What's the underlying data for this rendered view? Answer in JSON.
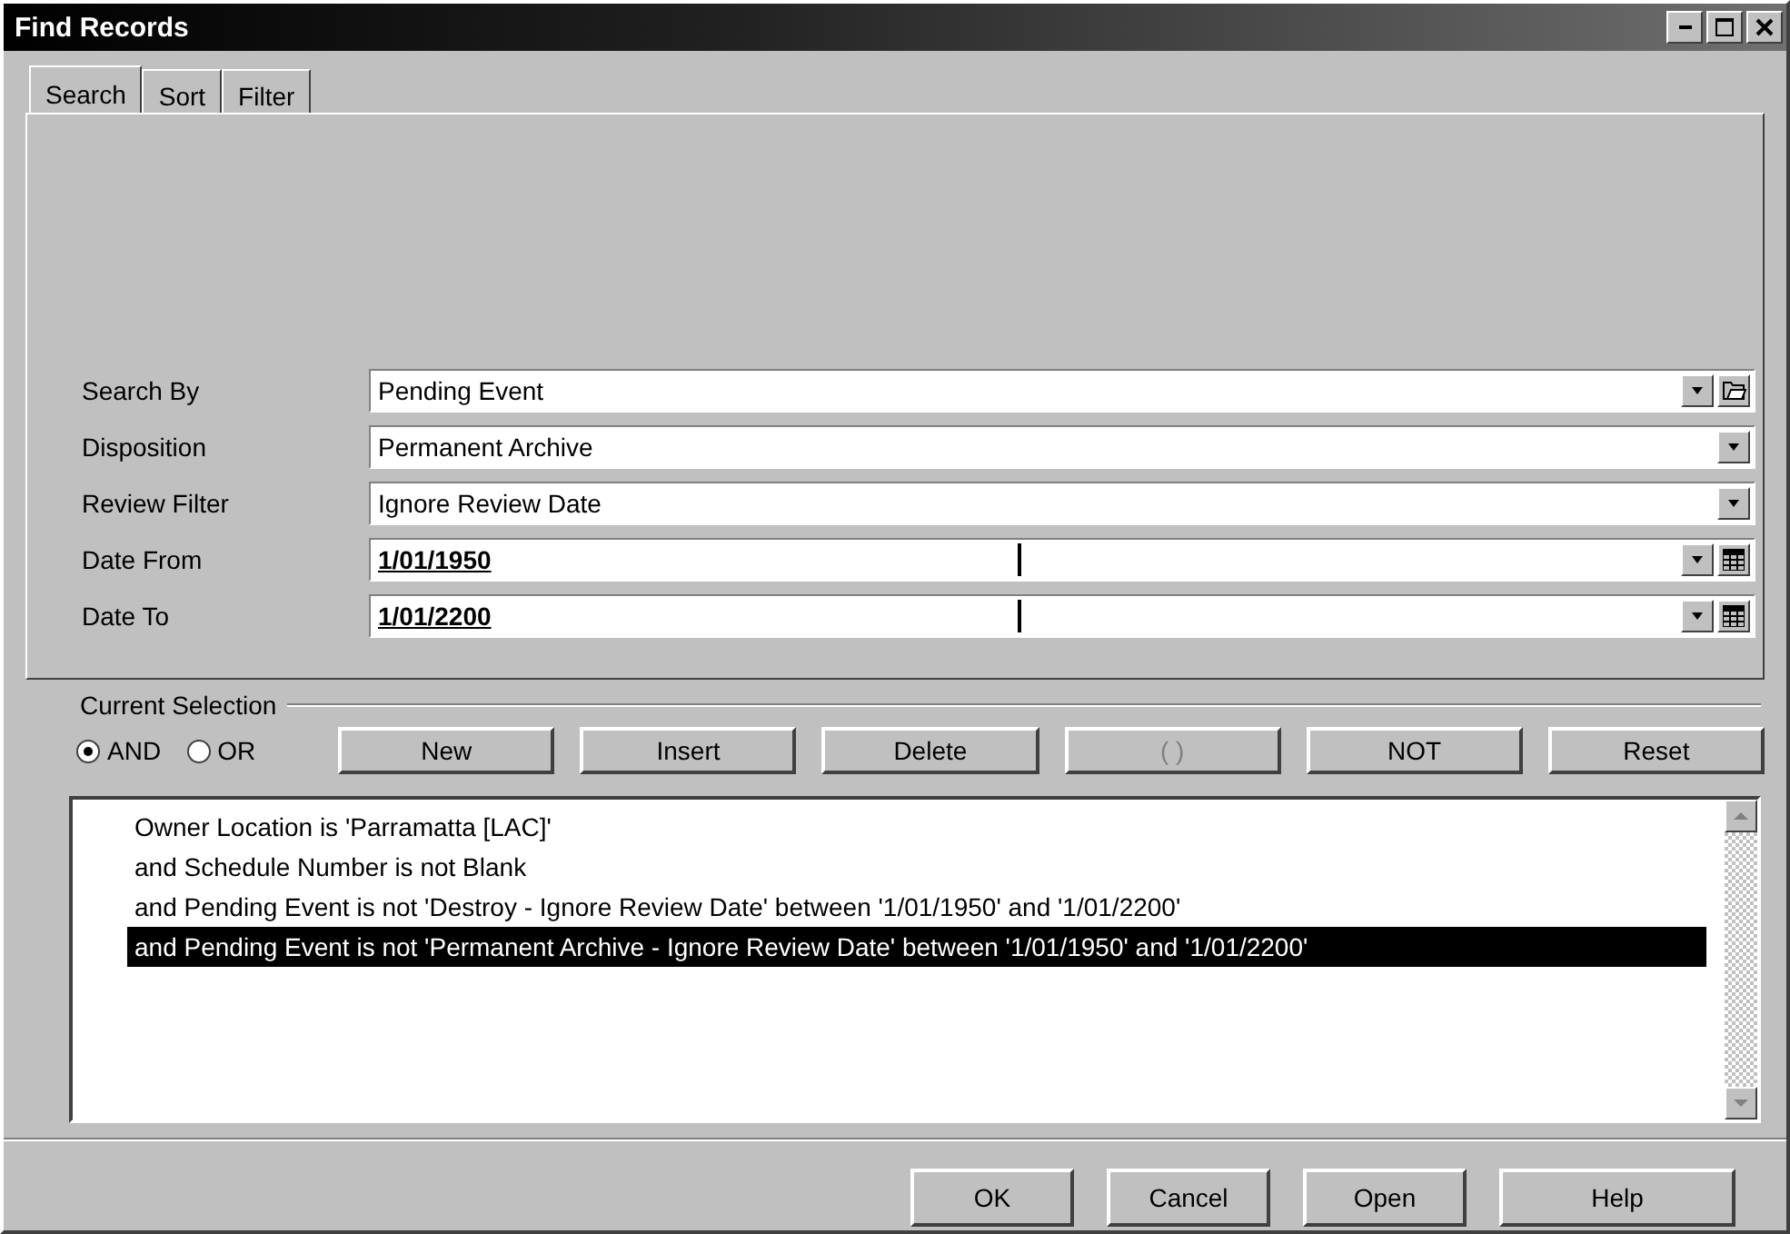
{
  "window": {
    "title": "Find Records"
  },
  "tabs": [
    {
      "label": "Search",
      "selected": true
    },
    {
      "label": "Sort",
      "selected": false
    },
    {
      "label": "Filter",
      "selected": false
    }
  ],
  "fields": [
    {
      "kind": "combo",
      "label": "Search By",
      "value": "Pending Event",
      "browse": true
    },
    {
      "kind": "combo",
      "label": "Disposition",
      "value": "Permanent Archive",
      "browse": false
    },
    {
      "kind": "combo",
      "label": "Review Filter",
      "value": "Ignore Review Date",
      "browse": false
    },
    {
      "kind": "date",
      "label": "Date From",
      "value": "1/01/1950"
    },
    {
      "kind": "date",
      "label": "Date To",
      "value": "1/01/2200"
    }
  ],
  "current_selection": {
    "label": "Current Selection",
    "radios": [
      {
        "label": "AND",
        "selected": true
      },
      {
        "label": "OR",
        "selected": false
      }
    ],
    "buttons": [
      {
        "label": "New",
        "disabled": false
      },
      {
        "label": "Insert",
        "disabled": false
      },
      {
        "label": "Delete",
        "disabled": false
      },
      {
        "label": "( )",
        "disabled": true
      },
      {
        "label": "NOT",
        "disabled": false
      },
      {
        "label": "Reset",
        "disabled": false
      }
    ],
    "items": [
      {
        "text": "Owner Location is 'Parramatta [LAC]'",
        "selected": false
      },
      {
        "text": "and Schedule Number is not Blank",
        "selected": false
      },
      {
        "text": "and Pending Event is not 'Destroy - Ignore Review Date' between '1/01/1950' and '1/01/2200'",
        "selected": false
      },
      {
        "text": "and Pending Event is not 'Permanent Archive - Ignore Review Date' between '1/01/1950' and '1/01/2200'",
        "selected": true
      }
    ]
  },
  "buttons": [
    "OK",
    "Cancel",
    "Open",
    "Help"
  ]
}
